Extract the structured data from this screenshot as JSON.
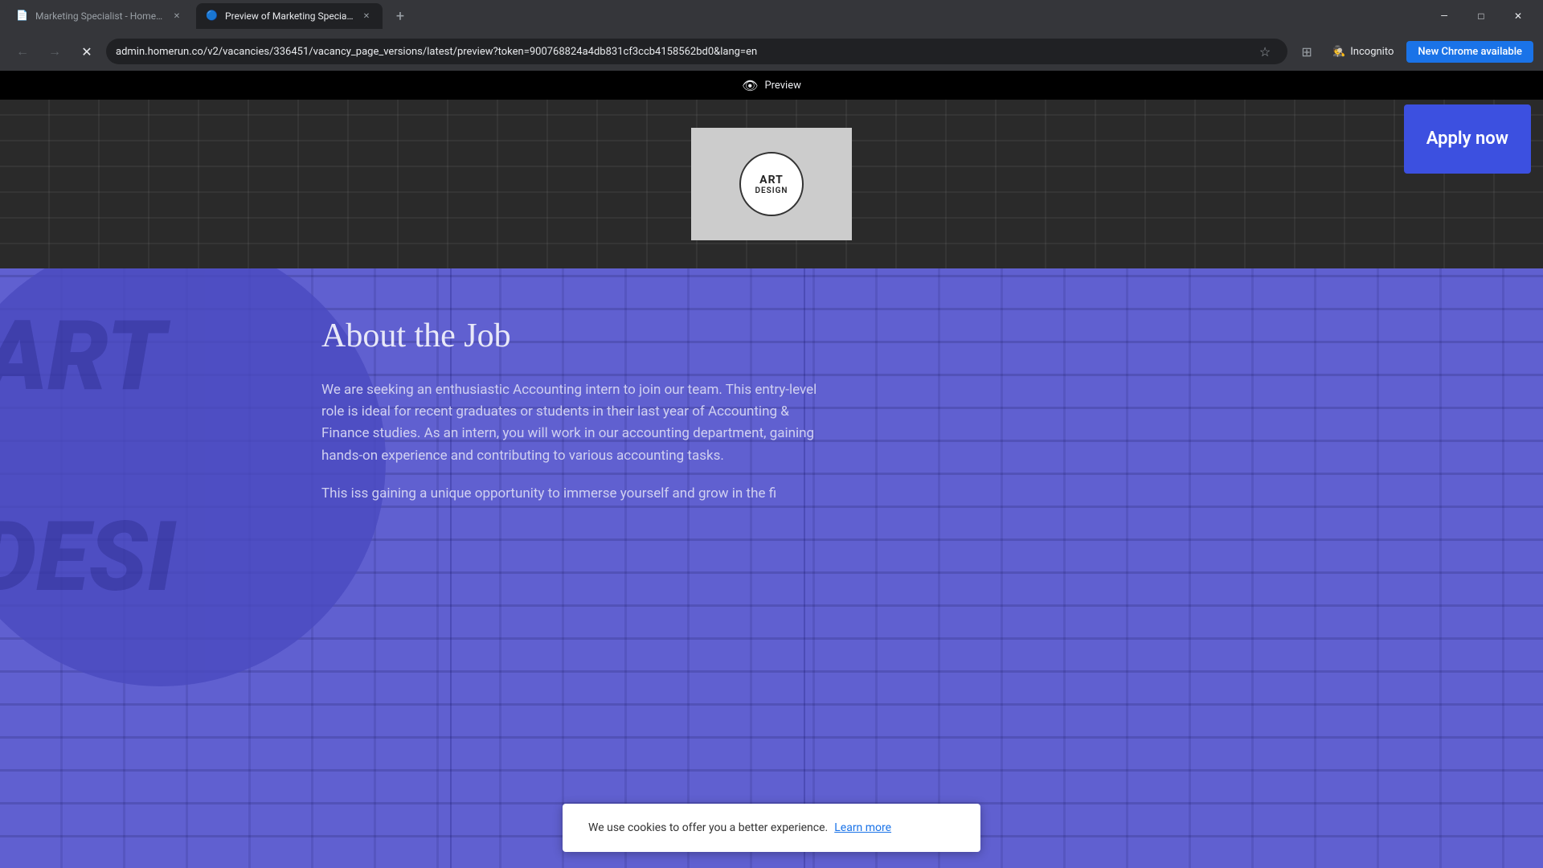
{
  "browser": {
    "tabs": [
      {
        "id": "tab1",
        "title": "Marketing Specialist - Homerun",
        "favicon": "📄",
        "active": false
      },
      {
        "id": "tab2",
        "title": "Preview of Marketing Specialis...",
        "favicon": "🔵",
        "active": true
      }
    ],
    "new_tab_label": "+",
    "address_bar": {
      "url": "admin.homerun.co/v2/vacancies/336451/vacancy_page_versions/latest/preview?token=900768824a4db831cf3ccb4158562bd0&lang=en"
    },
    "window_controls": {
      "minimize": "—",
      "maximize": "□",
      "close": "✕"
    },
    "toolbar_icons": {
      "back": "←",
      "forward": "→",
      "reload": "✕",
      "bookmark": "☆",
      "extensions": "⊞",
      "incognito": "Incognito"
    },
    "new_chrome_label": "New Chrome available"
  },
  "preview_bar": {
    "icon": "👁",
    "label": "Preview"
  },
  "apply_button": {
    "label": "Apply now"
  },
  "hero": {
    "logo_line1": "ART",
    "logo_line2": "DESIGN"
  },
  "main_content": {
    "heading": "About the Job",
    "paragraph1": "We are seeking an enthusiastic Accounting intern to join our team. This entry-level role is ideal for recent graduates or students in their last year of Accounting & Finance studies. As an intern, you will work in our accounting department, gaining hands-on experience and contributing to various accounting tasks.",
    "paragraph2": "This is"
  },
  "cookie_banner": {
    "text": "We use cookies to offer you a better experience.",
    "link_text": "Learn more"
  },
  "watermark": {
    "line1": "ART",
    "line2": "DESI"
  }
}
